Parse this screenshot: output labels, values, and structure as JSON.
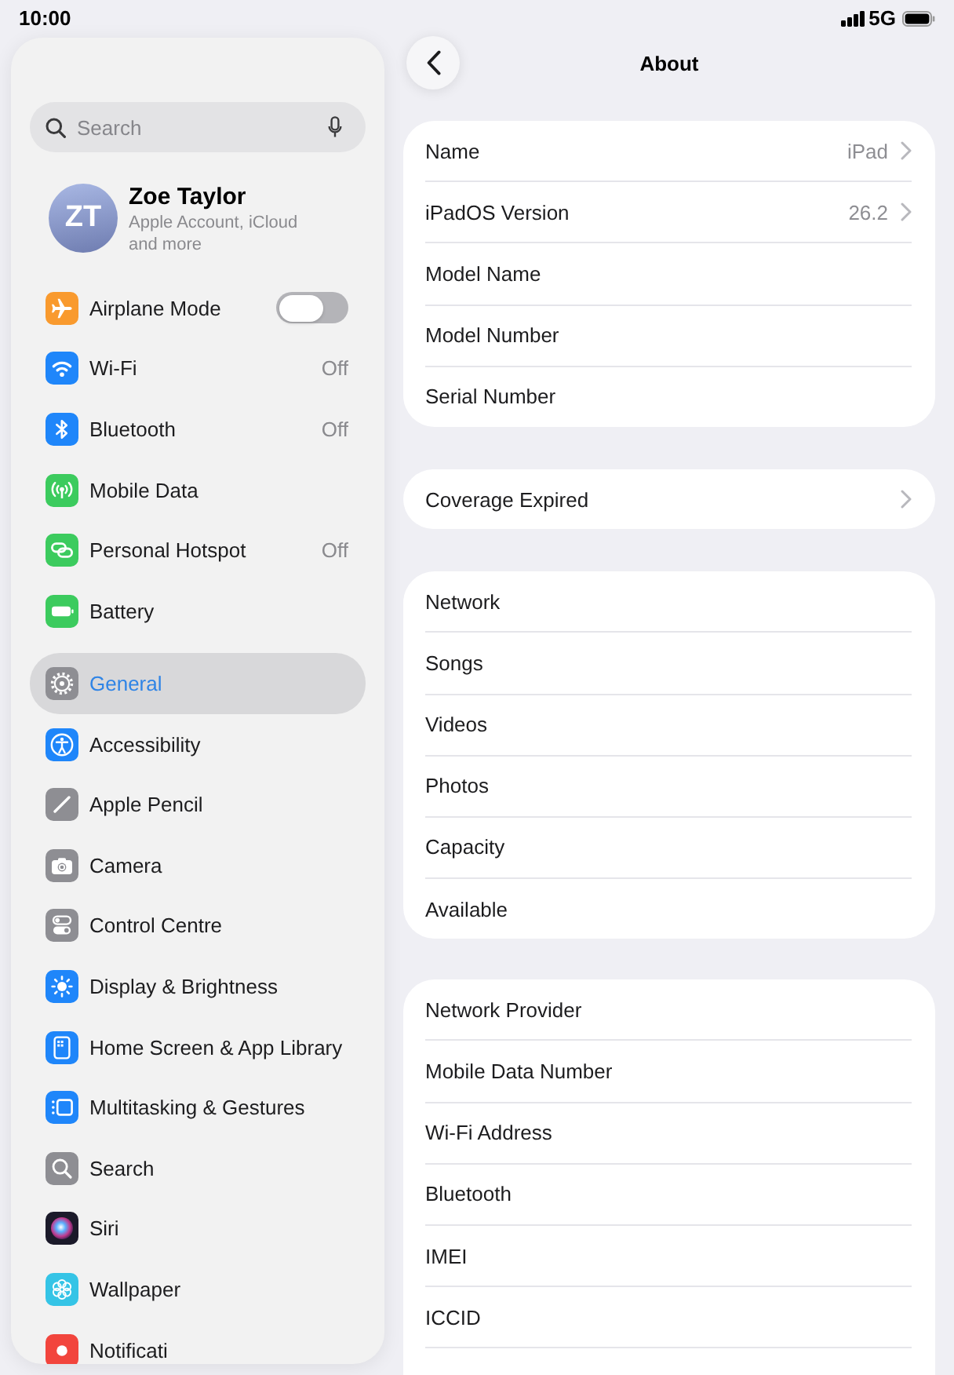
{
  "status_bar": {
    "time": "10:00",
    "network": "5G"
  },
  "sidebar": {
    "search": {
      "placeholder": "Search"
    },
    "account": {
      "initials": "ZT",
      "name": "Zoe Taylor",
      "subtitle": "Apple Account, iCloud and more"
    },
    "groups": [
      {
        "items": [
          {
            "label": "Airplane Mode",
            "kind": "toggle",
            "on": false,
            "selected": false
          },
          {
            "label": "Wi-Fi",
            "kind": "link",
            "value": "Off",
            "selected": false
          },
          {
            "label": "Bluetooth",
            "kind": "link",
            "value": "Off",
            "selected": false
          },
          {
            "label": "Mobile Data",
            "kind": "link",
            "selected": false
          },
          {
            "label": "Personal Hotspot",
            "kind": "link",
            "value": "Off",
            "selected": false
          },
          {
            "label": "Battery",
            "kind": "link",
            "selected": false
          }
        ]
      },
      {
        "items": [
          {
            "label": "General",
            "kind": "link",
            "selected": true
          },
          {
            "label": "Accessibility",
            "kind": "link",
            "selected": false
          },
          {
            "label": "Apple Pencil",
            "kind": "link",
            "selected": false
          },
          {
            "label": "Camera",
            "kind": "link",
            "selected": false
          },
          {
            "label": "Control Centre",
            "kind": "link",
            "selected": false
          },
          {
            "label": "Display & Brightness",
            "kind": "link",
            "selected": false
          },
          {
            "label": "Home Screen & App Library",
            "kind": "link",
            "selected": false
          },
          {
            "label": "Multitasking & Gestures",
            "kind": "link",
            "selected": false
          },
          {
            "label": "Search",
            "kind": "link",
            "selected": false
          },
          {
            "label": "Siri",
            "kind": "link",
            "selected": false
          },
          {
            "label": "Wallpaper",
            "kind": "link",
            "selected": false
          },
          {
            "label": "Notificati",
            "kind": "link",
            "selected": false
          }
        ]
      }
    ]
  },
  "detail": {
    "title": "About",
    "sections": [
      {
        "rows": [
          {
            "label": "Name",
            "value": "iPad",
            "chevron": true
          },
          {
            "label": "iPadOS Version",
            "value": "26.2",
            "chevron": true
          },
          {
            "label": "Model Name",
            "chevron": false
          },
          {
            "label": "Model Number",
            "chevron": false
          },
          {
            "label": "Serial Number",
            "chevron": false
          }
        ]
      },
      {
        "rows": [
          {
            "label": "Coverage Expired",
            "chevron": true
          }
        ]
      },
      {
        "rows": [
          {
            "label": "Network",
            "chevron": false
          },
          {
            "label": "Songs",
            "chevron": false
          },
          {
            "label": "Videos",
            "chevron": false
          },
          {
            "label": "Photos",
            "chevron": false
          },
          {
            "label": "Capacity",
            "chevron": false
          },
          {
            "label": "Available",
            "chevron": false
          }
        ]
      },
      {
        "rows": [
          {
            "label": "Network Provider",
            "chevron": false
          },
          {
            "label": "Mobile Data Number",
            "chevron": false
          },
          {
            "label": "Wi-Fi Address",
            "chevron": false
          },
          {
            "label": "Bluetooth",
            "chevron": false
          },
          {
            "label": "IMEI",
            "chevron": false
          },
          {
            "label": "ICCID",
            "chevron": false
          }
        ]
      }
    ]
  }
}
